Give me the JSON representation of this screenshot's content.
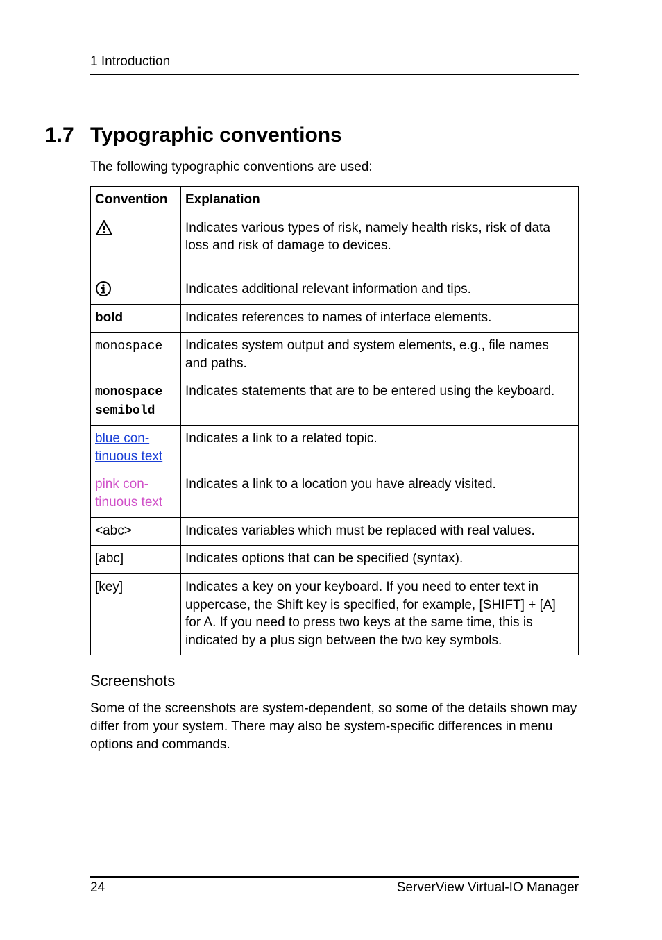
{
  "header": {
    "running": "1 Introduction"
  },
  "section": {
    "number": "1.7",
    "title": "Typographic conventions"
  },
  "intro": "The following typographic conventions are used:",
  "table": {
    "headers": {
      "convention": "Convention",
      "explanation": "Explanation"
    },
    "rows": [
      {
        "key": "warning-icon",
        "conv_text": "",
        "expl": "Indicates various types of risk, namely health risks, risk of data loss and risk of damage to devices."
      },
      {
        "key": "info-icon",
        "conv_text": "",
        "expl": "Indicates additional relevant information and tips."
      },
      {
        "key": "bold",
        "conv_text": "bold",
        "expl": "Indicates references to names of interface elements."
      },
      {
        "key": "monospace",
        "conv_text": "monospace",
        "expl": "Indicates system output and system elements, e.g., file names and paths."
      },
      {
        "key": "monospace-semibold",
        "conv_line1": "monospace",
        "conv_line2": "semibold",
        "expl": "Indicates statements that are to be entered using the keyboard."
      },
      {
        "key": "blue-link",
        "conv_line1": "blue con-",
        "conv_line2": "tinuous text",
        "expl": "Indicates a link to a related topic."
      },
      {
        "key": "pink-link",
        "conv_line1": "pink con-",
        "conv_line2": "tinuous text",
        "expl": "Indicates a link to a location you have already visited."
      },
      {
        "key": "angle",
        "conv_text": "<abc>",
        "expl": "Indicates variables which must be replaced with real values."
      },
      {
        "key": "square",
        "conv_text": "[abc]",
        "expl": "Indicates options that can be specified (syntax)."
      },
      {
        "key": "key",
        "conv_text": "[key]",
        "expl": "Indicates a key on your keyboard. If you need to enter text in uppercase, the Shift key is specified, for example, [SHIFT] + [A] for A. If you need to press two keys at the same time, this is indicated by a plus sign between the two key symbols."
      }
    ]
  },
  "screenshots": {
    "heading": "Screenshots",
    "para": "Some of the screenshots are system-dependent, so some of the details shown may differ from your system. There may also be system-specific differences in menu options and commands."
  },
  "footer": {
    "page": "24",
    "product": "ServerView Virtual-IO Manager"
  },
  "colors": {
    "link_blue": "#1a3fd6",
    "link_pink": "#d050c8"
  }
}
